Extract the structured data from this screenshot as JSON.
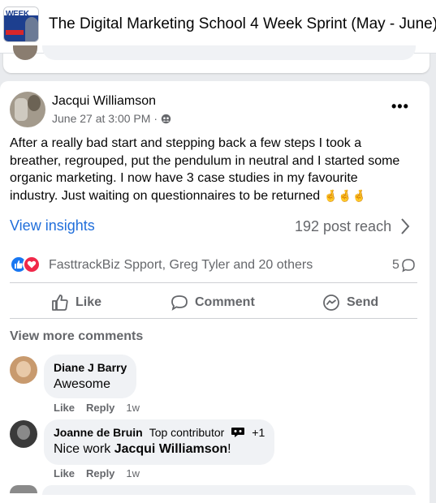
{
  "header": {
    "title": "The Digital Marketing School 4 Week Sprint (May - June)",
    "thumb_text": "WEEK"
  },
  "post": {
    "author": "Jacqui Williamson",
    "time": "June 27 at 3:00 PM",
    "separator": "·",
    "text_lines": [
      "After a really bad start and stepping back a few steps I took a",
      "breather, regrouped, put the pendulum in neutral and I started some",
      "organic marketing. I now have  3 case studies in my favourite",
      "industry.  Just waiting on questionnaires to be returned"
    ],
    "emoji": "🤞🤞🤞",
    "more_label": "•••",
    "insights_label": "View insights",
    "reach_label": "192 post reach",
    "reactors": "FasttrackBiz Spport, Greg Tyler and 20 others",
    "comment_count": "5",
    "actions": {
      "like": "Like",
      "comment": "Comment",
      "send": "Send"
    }
  },
  "comments": {
    "view_more": "View more comments",
    "items": [
      {
        "name": "Diane J Barry",
        "text": "Awesome",
        "like": "Like",
        "reply": "Reply",
        "time": "1w"
      },
      {
        "name": "Joanne de Bruin",
        "badge": "Top contributor",
        "badge_extra": "+1",
        "text_prefix": "Nice work ",
        "mention": "Jacqui Williamson",
        "text_suffix": "!",
        "like": "Like",
        "reply": "Reply",
        "time": "1w"
      }
    ]
  },
  "colors": {
    "link": "#216fdb",
    "muted": "#65676b",
    "like_blue": "#1877f2",
    "love_red": "#f02849"
  }
}
